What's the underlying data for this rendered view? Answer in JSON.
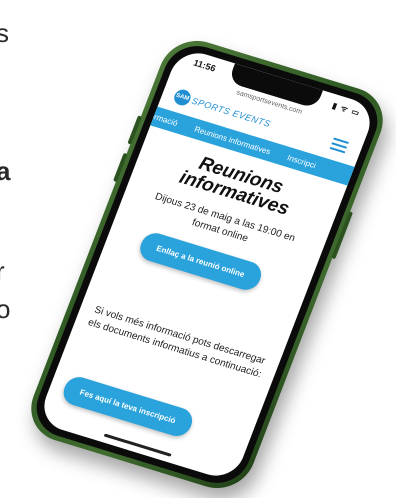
{
  "background": {
    "fragments": [
      "s",
      "a",
      "r",
      "o"
    ]
  },
  "phone": {
    "status": {
      "time": "11:56",
      "icons": "▮ ᯤ ▭"
    },
    "url": "samsportsevents.com",
    "header": {
      "logo_mark": "SAM",
      "logo_text": "SPORTS EVENTS"
    },
    "nav": [
      "formació",
      "Reunions informatives",
      "Inscripci"
    ],
    "title": "Reunions informatives",
    "subtitle": "Dijous 23 de maig a las 19:00 en format online",
    "meeting_button": "Enllaç a la reunió online",
    "more_info": "Si vols més informació pots descarregar els documents informatius a continuació:",
    "signup_button": "Fes aquí la teva inscripció"
  },
  "colors": {
    "accent": "#2aa3dd",
    "phone_body": "#3f6b2f"
  }
}
